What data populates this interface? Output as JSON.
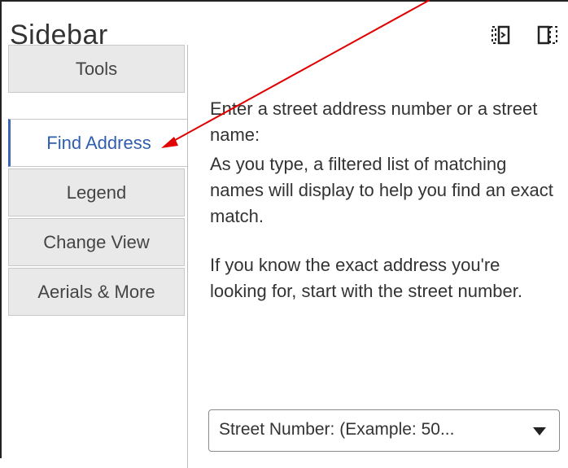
{
  "sidebar": {
    "title": "Sidebar",
    "header_icons": [
      "collapse-panel-icon",
      "dock-panel-icon"
    ]
  },
  "tabs": [
    {
      "label": "Tools",
      "active": false
    },
    {
      "label": "Find Address",
      "active": true
    },
    {
      "label": "Legend",
      "active": false
    },
    {
      "label": "Change View",
      "active": false
    },
    {
      "label": "Aerials & More",
      "active": false
    }
  ],
  "content": {
    "instruction_1": "Enter a street address number or a street name:",
    "instruction_2": "As you type, a filtered list of matching names will display to help you find an exact match.",
    "instruction_3": "If you know the exact address you're looking for, start with the street number.",
    "dropdown_selected": "Street Number: (Example: 50..."
  },
  "colors": {
    "accent": "#2f5fae",
    "tab_bg": "#e9e9e9",
    "annotation_arrow": "#e00000"
  }
}
